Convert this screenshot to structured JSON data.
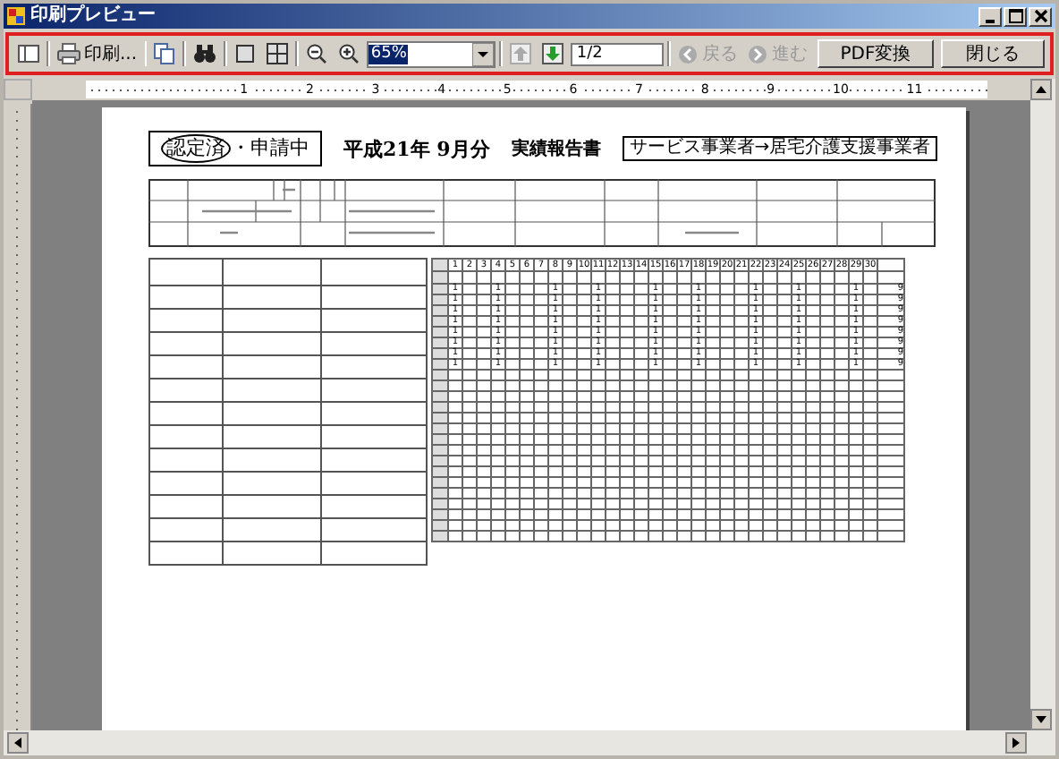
{
  "window": {
    "title": "印刷プレビュー"
  },
  "toolbar": {
    "print_button": {
      "label": "印刷..."
    },
    "zoom_combo": {
      "value": "65%"
    },
    "prev_page": {
      "disabled": true
    },
    "next_page": {
      "disabled": false
    },
    "page_field": {
      "value": "1/2"
    },
    "back": {
      "label": "戻る",
      "disabled": true
    },
    "forward": {
      "label": "進む",
      "disabled": true
    },
    "pdf_button": {
      "label": "PDF変換"
    },
    "close_button": {
      "label": "閉じる"
    }
  },
  "ruler": [
    "1",
    "2",
    "3",
    "4",
    "5",
    "6",
    "7",
    "8",
    "9",
    "10",
    "11"
  ],
  "document": {
    "status_options": [
      {
        "label": "認定済",
        "selected": true
      },
      {
        "label": "申請中",
        "selected": false
      }
    ],
    "separator": "・",
    "period": "平成21年 9月分",
    "title": "実績報告書",
    "route": "サービス事業者→居宅介護支援事業者",
    "schedule": {
      "days": [
        "1",
        "2",
        "3",
        "4",
        "5",
        "6",
        "7",
        "8",
        "9",
        "10",
        "11",
        "12",
        "13",
        "14",
        "15",
        "16",
        "17",
        "18",
        "19",
        "20",
        "21",
        "22",
        "23",
        "24",
        "25",
        "26",
        "27",
        "28",
        "29",
        "30"
      ],
      "rows": [
        {
          "cells": [
            {
              "kind": "mark",
              "text": "1"
            },
            {
              "kind": "blank"
            },
            {
              "kind": "blank"
            },
            {
              "kind": "mark",
              "text": "1"
            },
            {
              "kind": "blank"
            },
            {
              "kind": "blank"
            },
            {
              "kind": "blank"
            },
            {
              "kind": "mark",
              "text": "1"
            },
            {
              "kind": "blank"
            },
            {
              "kind": "blank"
            },
            {
              "kind": "mark",
              "text": "1"
            },
            {
              "kind": "blank"
            },
            {
              "kind": "blank"
            },
            {
              "kind": "blank"
            },
            {
              "kind": "mark",
              "text": "1"
            },
            {
              "kind": "blank"
            },
            {
              "kind": "blank"
            },
            {
              "kind": "mark",
              "text": "1"
            },
            {
              "kind": "blank"
            },
            {
              "kind": "blank"
            },
            {
              "kind": "blank"
            },
            {
              "kind": "mark",
              "text": "1"
            },
            {
              "kind": "blank"
            },
            {
              "kind": "blank"
            },
            {
              "kind": "mark",
              "text": "1"
            },
            {
              "kind": "blank"
            },
            {
              "kind": "blank"
            },
            {
              "kind": "blank"
            },
            {
              "kind": "mark",
              "text": "1"
            },
            {
              "kind": "blank"
            }
          ],
          "total": "9"
        },
        {
          "cells": [
            {
              "kind": "mark",
              "text": "1"
            },
            {
              "kind": "blank"
            },
            {
              "kind": "blank"
            },
            {
              "kind": "mark",
              "text": "1"
            },
            {
              "kind": "blank"
            },
            {
              "kind": "blank"
            },
            {
              "kind": "blank"
            },
            {
              "kind": "mark",
              "text": "1"
            },
            {
              "kind": "blank"
            },
            {
              "kind": "blank"
            },
            {
              "kind": "mark",
              "text": "1"
            },
            {
              "kind": "blank"
            },
            {
              "kind": "blank"
            },
            {
              "kind": "blank"
            },
            {
              "kind": "mark",
              "text": "1"
            },
            {
              "kind": "blank"
            },
            {
              "kind": "blank"
            },
            {
              "kind": "mark",
              "text": "1"
            },
            {
              "kind": "blank"
            },
            {
              "kind": "blank"
            },
            {
              "kind": "blank"
            },
            {
              "kind": "mark",
              "text": "1"
            },
            {
              "kind": "blank"
            },
            {
              "kind": "blank"
            },
            {
              "kind": "mark",
              "text": "1"
            },
            {
              "kind": "blank"
            },
            {
              "kind": "blank"
            },
            {
              "kind": "blank"
            },
            {
              "kind": "mark",
              "text": "1"
            },
            {
              "kind": "blank"
            }
          ],
          "total": "9"
        },
        {
          "cells": [
            {
              "kind": "mark",
              "text": "1"
            },
            {
              "kind": "blank"
            },
            {
              "kind": "blank"
            },
            {
              "kind": "mark",
              "text": "1"
            },
            {
              "kind": "blank"
            },
            {
              "kind": "blank"
            },
            {
              "kind": "blank"
            },
            {
              "kind": "mark",
              "text": "1"
            },
            {
              "kind": "blank"
            },
            {
              "kind": "blank"
            },
            {
              "kind": "mark",
              "text": "1"
            },
            {
              "kind": "blank"
            },
            {
              "kind": "blank"
            },
            {
              "kind": "blank"
            },
            {
              "kind": "mark",
              "text": "1"
            },
            {
              "kind": "blank"
            },
            {
              "kind": "blank"
            },
            {
              "kind": "mark",
              "text": "1"
            },
            {
              "kind": "blank"
            },
            {
              "kind": "blank"
            },
            {
              "kind": "blank"
            },
            {
              "kind": "mark",
              "text": "1"
            },
            {
              "kind": "blank"
            },
            {
              "kind": "blank"
            },
            {
              "kind": "mark",
              "text": "1"
            },
            {
              "kind": "blank"
            },
            {
              "kind": "blank"
            },
            {
              "kind": "blank"
            },
            {
              "kind": "mark",
              "text": "1"
            },
            {
              "kind": "blank"
            }
          ],
          "total": "9"
        },
        {
          "cells": [
            {
              "kind": "mark",
              "text": "1"
            },
            {
              "kind": "blank"
            },
            {
              "kind": "blank"
            },
            {
              "kind": "mark",
              "text": "1"
            },
            {
              "kind": "blank"
            },
            {
              "kind": "blank"
            },
            {
              "kind": "blank"
            },
            {
              "kind": "mark",
              "text": "1"
            },
            {
              "kind": "blank"
            },
            {
              "kind": "blank"
            },
            {
              "kind": "mark",
              "text": "1"
            },
            {
              "kind": "blank"
            },
            {
              "kind": "blank"
            },
            {
              "kind": "blank"
            },
            {
              "kind": "mark",
              "text": "1"
            },
            {
              "kind": "blank"
            },
            {
              "kind": "blank"
            },
            {
              "kind": "mark",
              "text": "1"
            },
            {
              "kind": "blank"
            },
            {
              "kind": "blank"
            },
            {
              "kind": "blank"
            },
            {
              "kind": "mark",
              "text": "1"
            },
            {
              "kind": "blank"
            },
            {
              "kind": "blank"
            },
            {
              "kind": "mark",
              "text": "1"
            },
            {
              "kind": "blank"
            },
            {
              "kind": "blank"
            },
            {
              "kind": "blank"
            },
            {
              "kind": "mark",
              "text": "1"
            },
            {
              "kind": "blank"
            }
          ],
          "total": "9"
        },
        {
          "cells": [
            {
              "kind": "mark",
              "text": "1"
            },
            {
              "kind": "blank"
            },
            {
              "kind": "blank"
            },
            {
              "kind": "mark",
              "text": "1"
            },
            {
              "kind": "blank"
            },
            {
              "kind": "blank"
            },
            {
              "kind": "blank"
            },
            {
              "kind": "mark",
              "text": "1"
            },
            {
              "kind": "blank"
            },
            {
              "kind": "blank"
            },
            {
              "kind": "mark",
              "text": "1"
            },
            {
              "kind": "blank"
            },
            {
              "kind": "blank"
            },
            {
              "kind": "blank"
            },
            {
              "kind": "mark",
              "text": "1"
            },
            {
              "kind": "blank"
            },
            {
              "kind": "blank"
            },
            {
              "kind": "mark",
              "text": "1"
            },
            {
              "kind": "blank"
            },
            {
              "kind": "blank"
            },
            {
              "kind": "blank"
            },
            {
              "kind": "mark",
              "text": "1"
            },
            {
              "kind": "blank"
            },
            {
              "kind": "blank"
            },
            {
              "kind": "mark",
              "text": "1"
            },
            {
              "kind": "blank"
            },
            {
              "kind": "blank"
            },
            {
              "kind": "blank"
            },
            {
              "kind": "mark",
              "text": "1"
            },
            {
              "kind": "blank"
            }
          ],
          "total": "9"
        },
        {
          "cells": [
            {
              "kind": "mark",
              "text": "1"
            },
            {
              "kind": "blank"
            },
            {
              "kind": "blank"
            },
            {
              "kind": "mark",
              "text": "1"
            },
            {
              "kind": "blank"
            },
            {
              "kind": "blank"
            },
            {
              "kind": "blank"
            },
            {
              "kind": "mark",
              "text": "1"
            },
            {
              "kind": "blank"
            },
            {
              "kind": "blank"
            },
            {
              "kind": "mark",
              "text": "1"
            },
            {
              "kind": "blank"
            },
            {
              "kind": "blank"
            },
            {
              "kind": "blank"
            },
            {
              "kind": "mark",
              "text": "1"
            },
            {
              "kind": "blank"
            },
            {
              "kind": "blank"
            },
            {
              "kind": "mark",
              "text": "1"
            },
            {
              "kind": "blank"
            },
            {
              "kind": "blank"
            },
            {
              "kind": "blank"
            },
            {
              "kind": "mark",
              "text": "1"
            },
            {
              "kind": "blank"
            },
            {
              "kind": "blank"
            },
            {
              "kind": "mark",
              "text": "1"
            },
            {
              "kind": "blank"
            },
            {
              "kind": "blank"
            },
            {
              "kind": "blank"
            },
            {
              "kind": "mark",
              "text": "1"
            },
            {
              "kind": "blank"
            }
          ],
          "total": "9"
        },
        {
          "cells": [
            {
              "kind": "mark",
              "text": "1"
            },
            {
              "kind": "blank"
            },
            {
              "kind": "blank"
            },
            {
              "kind": "mark",
              "text": "1"
            },
            {
              "kind": "blank"
            },
            {
              "kind": "blank"
            },
            {
              "kind": "blank"
            },
            {
              "kind": "mark",
              "text": "1"
            },
            {
              "kind": "blank"
            },
            {
              "kind": "blank"
            },
            {
              "kind": "mark",
              "text": "1"
            },
            {
              "kind": "blank"
            },
            {
              "kind": "blank"
            },
            {
              "kind": "blank"
            },
            {
              "kind": "mark",
              "text": "1"
            },
            {
              "kind": "blank"
            },
            {
              "kind": "blank"
            },
            {
              "kind": "mark",
              "text": "1"
            },
            {
              "kind": "blank"
            },
            {
              "kind": "blank"
            },
            {
              "kind": "blank"
            },
            {
              "kind": "mark",
              "text": "1"
            },
            {
              "kind": "blank"
            },
            {
              "kind": "blank"
            },
            {
              "kind": "mark",
              "text": "1"
            },
            {
              "kind": "blank"
            },
            {
              "kind": "blank"
            },
            {
              "kind": "blank"
            },
            {
              "kind": "mark",
              "text": "1"
            },
            {
              "kind": "blank"
            }
          ],
          "total": "9"
        },
        {
          "cells": [
            {
              "kind": "mark",
              "text": "1"
            },
            {
              "kind": "blank"
            },
            {
              "kind": "blank"
            },
            {
              "kind": "mark",
              "text": "1"
            },
            {
              "kind": "blank"
            },
            {
              "kind": "blank"
            },
            {
              "kind": "blank"
            },
            {
              "kind": "mark",
              "text": "1"
            },
            {
              "kind": "blank"
            },
            {
              "kind": "blank"
            },
            {
              "kind": "mark",
              "text": "1"
            },
            {
              "kind": "blank"
            },
            {
              "kind": "blank"
            },
            {
              "kind": "blank"
            },
            {
              "kind": "mark",
              "text": "1"
            },
            {
              "kind": "blank"
            },
            {
              "kind": "blank"
            },
            {
              "kind": "mark",
              "text": "1"
            },
            {
              "kind": "blank"
            },
            {
              "kind": "blank"
            },
            {
              "kind": "blank"
            },
            {
              "kind": "mark",
              "text": "1"
            },
            {
              "kind": "blank"
            },
            {
              "kind": "blank"
            },
            {
              "kind": "mark",
              "text": "1"
            },
            {
              "kind": "blank"
            },
            {
              "kind": "blank"
            },
            {
              "kind": "blank"
            },
            {
              "kind": "mark",
              "text": "1"
            },
            {
              "kind": "blank"
            }
          ],
          "total": "9"
        }
      ]
    }
  }
}
